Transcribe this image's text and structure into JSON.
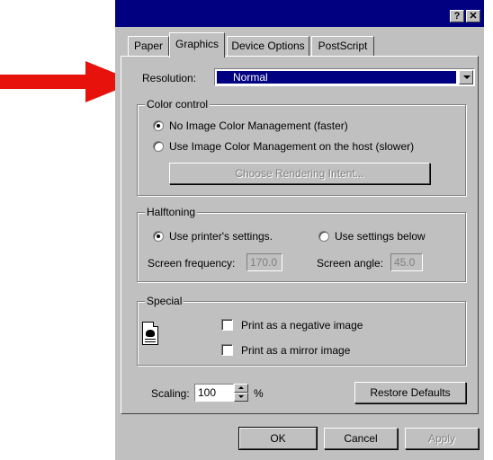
{
  "window": {
    "help_label": "?",
    "close_label": "✕"
  },
  "tabs": [
    {
      "label": "Paper",
      "active": false
    },
    {
      "label": "Graphics",
      "active": true
    },
    {
      "label": "Device Options",
      "active": false
    },
    {
      "label": "PostScript",
      "active": false
    }
  ],
  "resolution": {
    "label": "Resolution:",
    "value": "Normal"
  },
  "color_control": {
    "title": "Color control",
    "option_no_icm": "No Image Color Management (faster)",
    "option_use_icm": "Use Image Color Management on the host (slower)",
    "selected": "option_no_icm",
    "rendering_intent_button": "Choose Rendering Intent..."
  },
  "halftoning": {
    "title": "Halftoning",
    "option_printer": "Use printer's settings.",
    "option_below": "Use settings below",
    "selected": "option_printer",
    "frequency_label": "Screen frequency:",
    "frequency_value": "170.0",
    "angle_label": "Screen angle:",
    "angle_value": "45.0"
  },
  "special": {
    "title": "Special",
    "negative_label": "Print as a negative image",
    "mirror_label": "Print as a mirror image",
    "icon": "document-bird-icon"
  },
  "scaling": {
    "label": "Scaling:",
    "value": "100",
    "unit": "%"
  },
  "restore_defaults_label": "Restore Defaults",
  "footer": {
    "ok_label": "OK",
    "cancel_label": "Cancel",
    "apply_label": "Apply"
  },
  "colors": {
    "titlebar": "#000080",
    "face": "#c0c0c0",
    "arrow": "#e8120c"
  }
}
